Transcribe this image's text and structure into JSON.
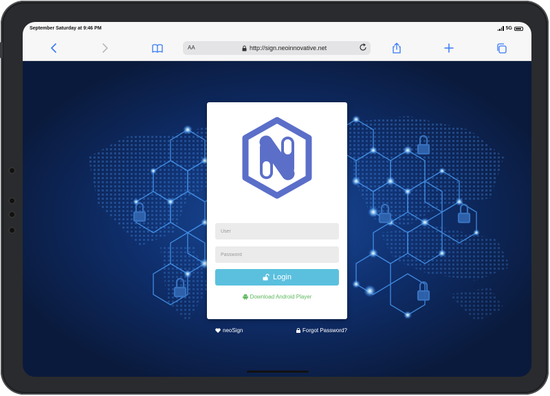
{
  "status_bar": {
    "time": "September Saturday at 9:46 PM",
    "network": "5G"
  },
  "browser": {
    "text_size_label": "AA",
    "url": "http://sign.neoinnovative.net",
    "icons": [
      "back-icon",
      "forward-icon",
      "bookmarks-icon",
      "lock-icon",
      "reload-icon",
      "share-icon",
      "new-tab-icon",
      "tabs-icon"
    ]
  },
  "login_form": {
    "logo_letter": "N",
    "user_placeholder": "User",
    "password_placeholder": "Password",
    "login_label": "Login",
    "download_label": "Download Android Player"
  },
  "footer": {
    "brand_label": "neoSign",
    "forgot_label": "Forgot Password?"
  },
  "colors": {
    "accent_login": "#5bc0de",
    "link_green": "#5cb85c",
    "logo_blue": "#5b6fc9",
    "background_blue": "#0f2f6d"
  }
}
